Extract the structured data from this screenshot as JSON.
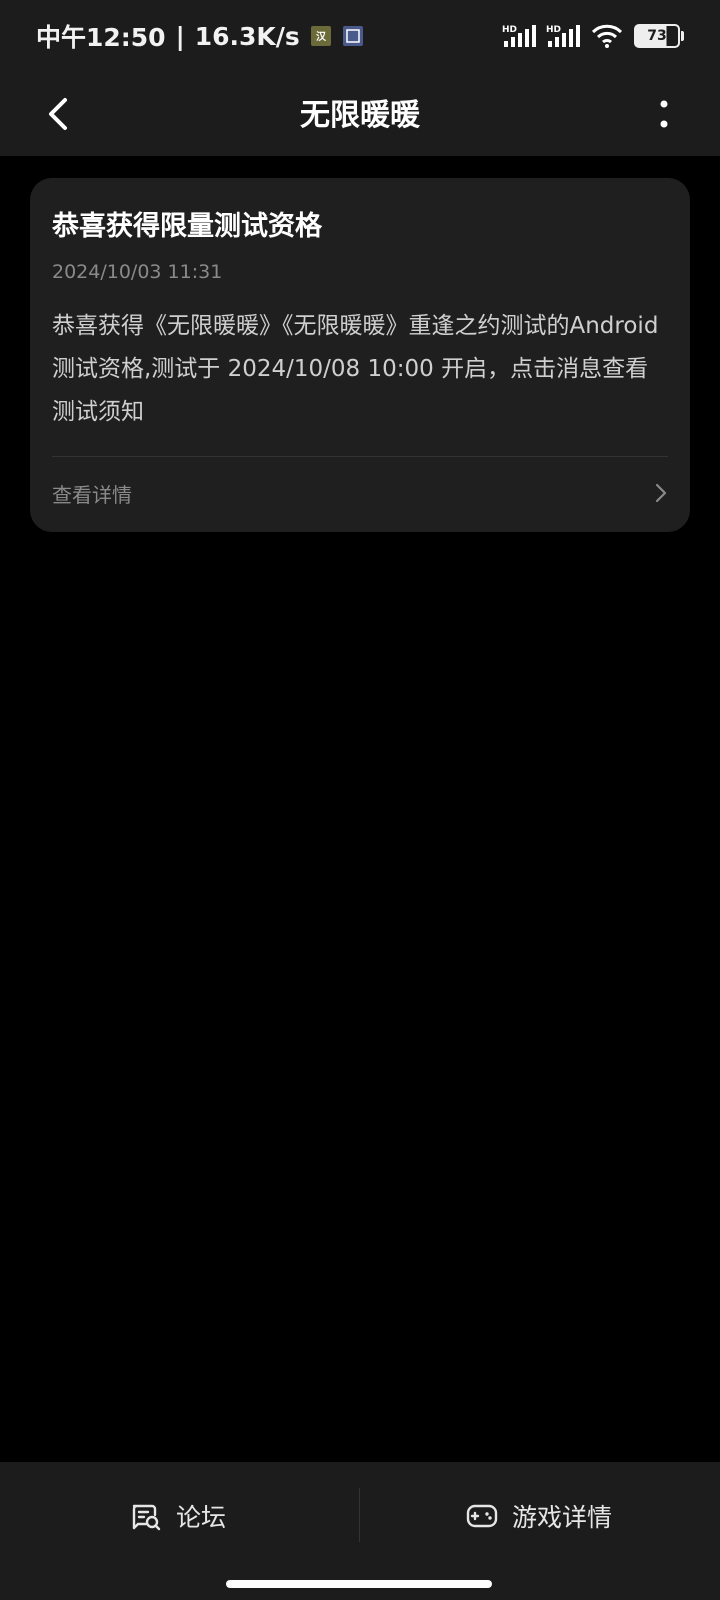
{
  "status_bar": {
    "time": "中午12:50",
    "network_speed": "16.3K/s",
    "left_icons": [
      "app-notification-icon",
      "app-notification-icon-2"
    ],
    "signal_1_label": "HD",
    "signal_2_label": "HD",
    "wifi_icon": "wifi-icon",
    "battery": "73"
  },
  "header": {
    "title": "无限暖暖",
    "back_icon": "chevron-left-icon",
    "more_icon": "more-vertical-icon"
  },
  "message_card": {
    "title": "恭喜获得限量测试资格",
    "timestamp": "2024/10/03 11:31",
    "body": "恭喜获得《无限暖暖》《无限暖暖》重逢之约测试的Android测试资格,测试于 2024/10/08 10:00 开启，点击消息查看测试须知",
    "action_label": "查看详情",
    "action_icon": "chevron-right-icon"
  },
  "bottom_nav": {
    "forum_label": "论坛",
    "forum_icon": "forum-chat-search-icon",
    "game_label": "游戏详情",
    "game_icon": "gamepad-icon"
  },
  "colors": {
    "bar_background": "#1c1c1c",
    "page_background": "#000000",
    "card_background": "#1f1f1f",
    "muted_text": "#8a8a8a"
  }
}
